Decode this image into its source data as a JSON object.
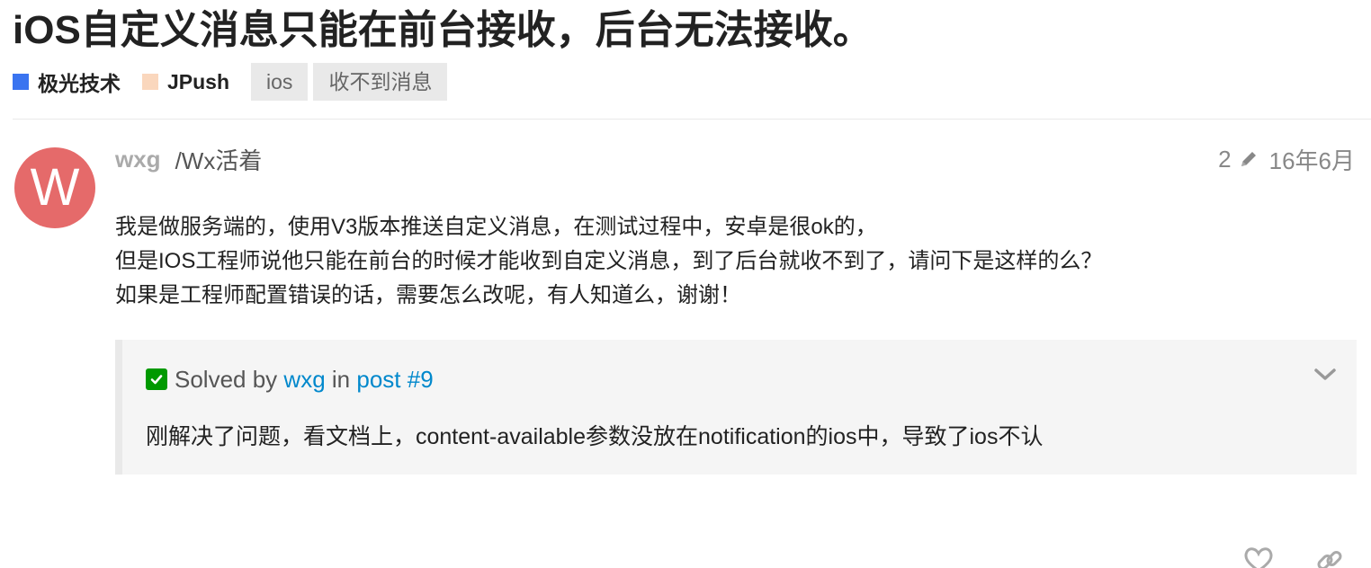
{
  "topic": {
    "title": "iOS自定义消息只能在前台接收，后台无法接收。",
    "categories": [
      {
        "label": "极光技术",
        "color": "#3a74f0"
      },
      {
        "label": "JPush",
        "color": "#fad7bd"
      }
    ],
    "tags": [
      "ios",
      "收不到消息"
    ]
  },
  "post": {
    "avatar_letter": "W",
    "avatar_color": "#e56a6a",
    "username": "wxg",
    "fullname": "/Wx活着",
    "edit_count": "2",
    "date": "16年6月",
    "lines": [
      "我是做服务端的，使用V3版本推送自定义消息，在测试过程中，安卓是很ok的，",
      "但是IOS工程师说他只能在前台的时候才能收到自定义消息，到了后台就收不到了，请问下是这样的么？",
      "如果是工程师配置错误的话，需要怎么改呢，有人知道么，谢谢！"
    ]
  },
  "solution": {
    "solved_by": "Solved by",
    "author": "wxg",
    "in": "in",
    "post_link": "post #9",
    "text": "刚解决了问题，看文档上，content-available参数没放在notification的ios中，导致了ios不认"
  },
  "icons": {
    "edit": "pencil-icon",
    "solved": "check-icon",
    "expand": "chevron-down-icon",
    "like": "heart-icon",
    "share": "link-icon"
  },
  "colors": {
    "link": "#0088cc",
    "solved": "#009900"
  }
}
